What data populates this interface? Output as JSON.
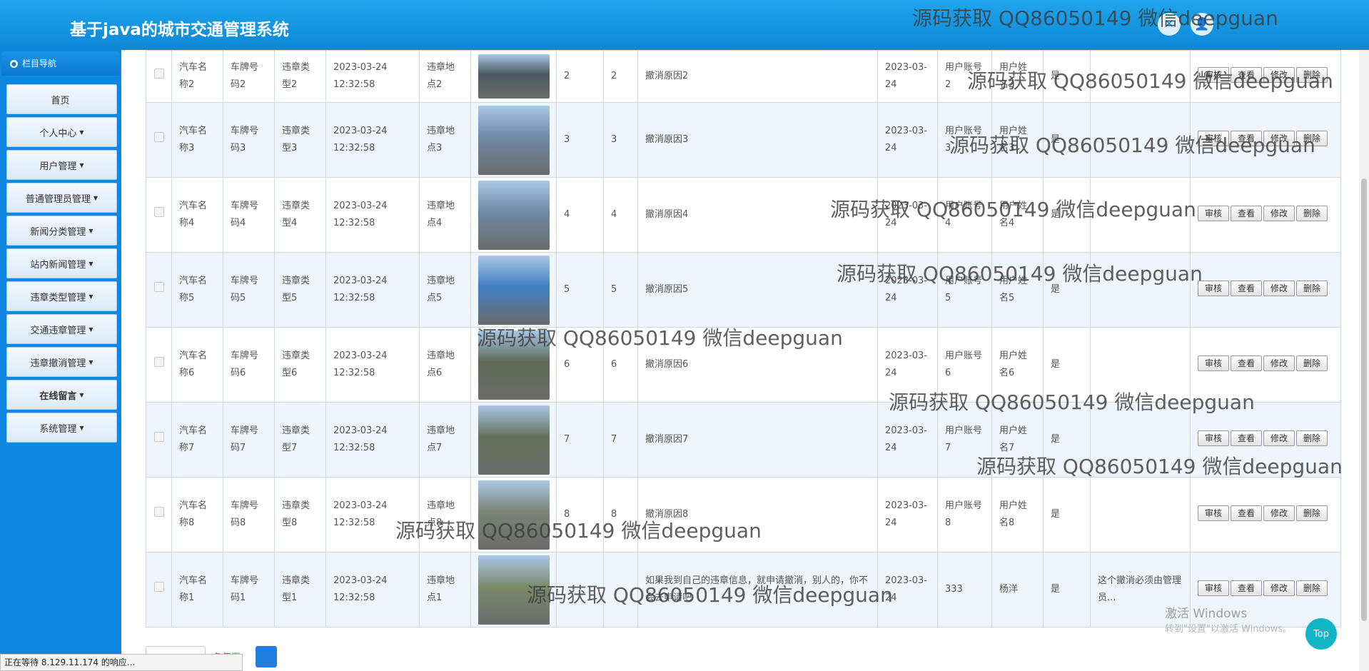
{
  "app": {
    "title": "基于java的城市交通管理系统"
  },
  "header": {
    "icon1": "close-x-icon",
    "icon2": "user-icon"
  },
  "sidebar": {
    "heading": "栏目导航",
    "items": [
      {
        "label": "首页",
        "caret": ""
      },
      {
        "label": "个人中心",
        "caret": "▼"
      },
      {
        "label": "用户管理",
        "caret": "▼"
      },
      {
        "label": "普通管理员管理",
        "caret": "▼"
      },
      {
        "label": "新闻分类管理",
        "caret": "▼"
      },
      {
        "label": "站内新闻管理",
        "caret": "▼"
      },
      {
        "label": "违章类型管理",
        "caret": "▼"
      },
      {
        "label": "交通违章管理",
        "caret": "▼"
      },
      {
        "label": "违章撤消管理",
        "caret": "▼"
      },
      {
        "label": "在线留言",
        "caret": "▼"
      },
      {
        "label": "系统管理",
        "caret": "▼"
      }
    ]
  },
  "actions": {
    "audit": "审核",
    "view": "查看",
    "edit": "修改",
    "delete": "删除"
  },
  "table": {
    "rows": [
      {
        "car": "汽车名称2",
        "plate": "车牌号码2",
        "type": "违章类型2",
        "time": "2023-03-24 12:32:58",
        "place": "违章地点2",
        "img_color": "#4b5a60",
        "n1": "2",
        "n2": "2",
        "reason": "撤消原因2",
        "date": "2023-03-24",
        "account": "用户账号2",
        "name": "用户姓名2",
        "flag": "是",
        "reply": ""
      },
      {
        "car": "汽车名称3",
        "plate": "车牌号码3",
        "type": "违章类型3",
        "time": "2023-03-24 12:32:58",
        "place": "违章地点3",
        "img_color": "#6f8aa6",
        "n1": "3",
        "n2": "3",
        "reason": "撤消原因3",
        "date": "2023-03-24",
        "account": "用户账号3",
        "name": "用户姓名3",
        "flag": "是",
        "reply": ""
      },
      {
        "car": "汽车名称4",
        "plate": "车牌号码4",
        "type": "违章类型4",
        "time": "2023-03-24 12:32:58",
        "place": "违章地点4",
        "img_color": "#6f8aa6",
        "n1": "4",
        "n2": "4",
        "reason": "撤消原因4",
        "date": "2023-03-24",
        "account": "用户账号4",
        "name": "用户姓名4",
        "flag": "是",
        "reply": ""
      },
      {
        "car": "汽车名称5",
        "plate": "车牌号码5",
        "type": "违章类型5",
        "time": "2023-03-24 12:32:58",
        "place": "违章地点5",
        "img_color": "#3f7fc4",
        "n1": "5",
        "n2": "5",
        "reason": "撤消原因5",
        "date": "2023-03-24",
        "account": "用户账号5",
        "name": "用户姓名5",
        "flag": "是",
        "reply": ""
      },
      {
        "car": "汽车名称6",
        "plate": "车牌号码6",
        "type": "违章类型6",
        "time": "2023-03-24 12:32:58",
        "place": "违章地点6",
        "img_color": "#5d6a55",
        "n1": "6",
        "n2": "6",
        "reason": "撤消原因6",
        "date": "2023-03-24",
        "account": "用户账号6",
        "name": "用户姓名6",
        "flag": "是",
        "reply": ""
      },
      {
        "car": "汽车名称7",
        "plate": "车牌号码7",
        "type": "违章类型7",
        "time": "2023-03-24 12:32:58",
        "place": "违章地点7",
        "img_color": "#66715a",
        "n1": "7",
        "n2": "7",
        "reason": "撤消原因7",
        "date": "2023-03-24",
        "account": "用户账号7",
        "name": "用户姓名7",
        "flag": "是",
        "reply": ""
      },
      {
        "car": "汽车名称8",
        "plate": "车牌号码8",
        "type": "违章类型8",
        "time": "2023-03-24 12:32:58",
        "place": "违章地点8",
        "img_color": "#7a8578",
        "n1": "8",
        "n2": "8",
        "reason": "撤消原因8",
        "date": "2023-03-24",
        "account": "用户账号8",
        "name": "用户姓名8",
        "flag": "是",
        "reply": ""
      },
      {
        "car": "汽车名称1",
        "plate": "车牌号码1",
        "type": "违章类型1",
        "time": "2023-03-24 12:32:58",
        "place": "违章地点1",
        "img_color": "#7b8a6c",
        "n1": "",
        "n2": "",
        "reason": "如果我到自己的违章信息，就申请撤消，别人的，你不会去申请吧",
        "date": "2023-03-24",
        "account": "333",
        "name": "杨洋",
        "flag": "是",
        "reply": "这个撤消必须由管理员..."
      }
    ]
  },
  "pager": {
    "per_page": "条每页"
  },
  "watermark": {
    "text": "源码获取 QQ86050149 微信deepguan"
  },
  "windows": {
    "line1": "激活 Windows",
    "line2": "转到\"设置\"以激活 Windows。"
  },
  "top_button": "Top",
  "status_bar": "正在等待 8.129.11.174 的响应..."
}
